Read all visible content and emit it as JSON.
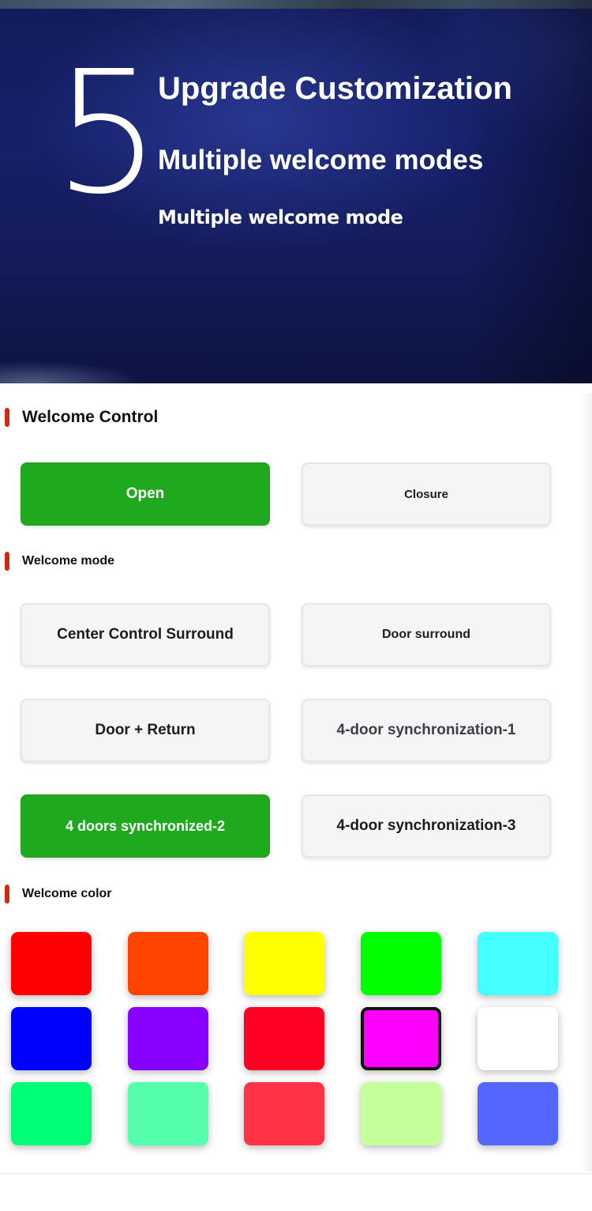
{
  "hero": {
    "number": "5",
    "title": "Upgrade Customization",
    "subtitle": "Multiple welcome modes",
    "subtitle2": "Multiple welcome mode"
  },
  "welcome_control": {
    "title": "Welcome Control",
    "open_label": "Open",
    "closure_label": "Closure",
    "selected": "Open"
  },
  "welcome_mode": {
    "title": "Welcome mode",
    "options": [
      "Center Control Surround",
      "Door surround",
      "Door + Return",
      "4-door synchronization-1",
      "4 doors synchronized-2",
      "4-door synchronization-3"
    ],
    "selected": "4 doors synchronized-2"
  },
  "welcome_color": {
    "title": "Welcome color",
    "swatches": [
      "#ff0000",
      "#ff4400",
      "#ffff00",
      "#00ff00",
      "#44ffff",
      "#0000ff",
      "#8800ff",
      "#ff0022",
      "#ff00ff",
      "#ffffff",
      "#00ff77",
      "#55ffaa",
      "#ff3344",
      "#c4ff99",
      "#5566ff"
    ],
    "selected": "#ff00ff"
  },
  "colors": {
    "active_green": "#1fa91f",
    "section_bar_red": "#cc2a12",
    "hero_blue": "#16206a"
  }
}
